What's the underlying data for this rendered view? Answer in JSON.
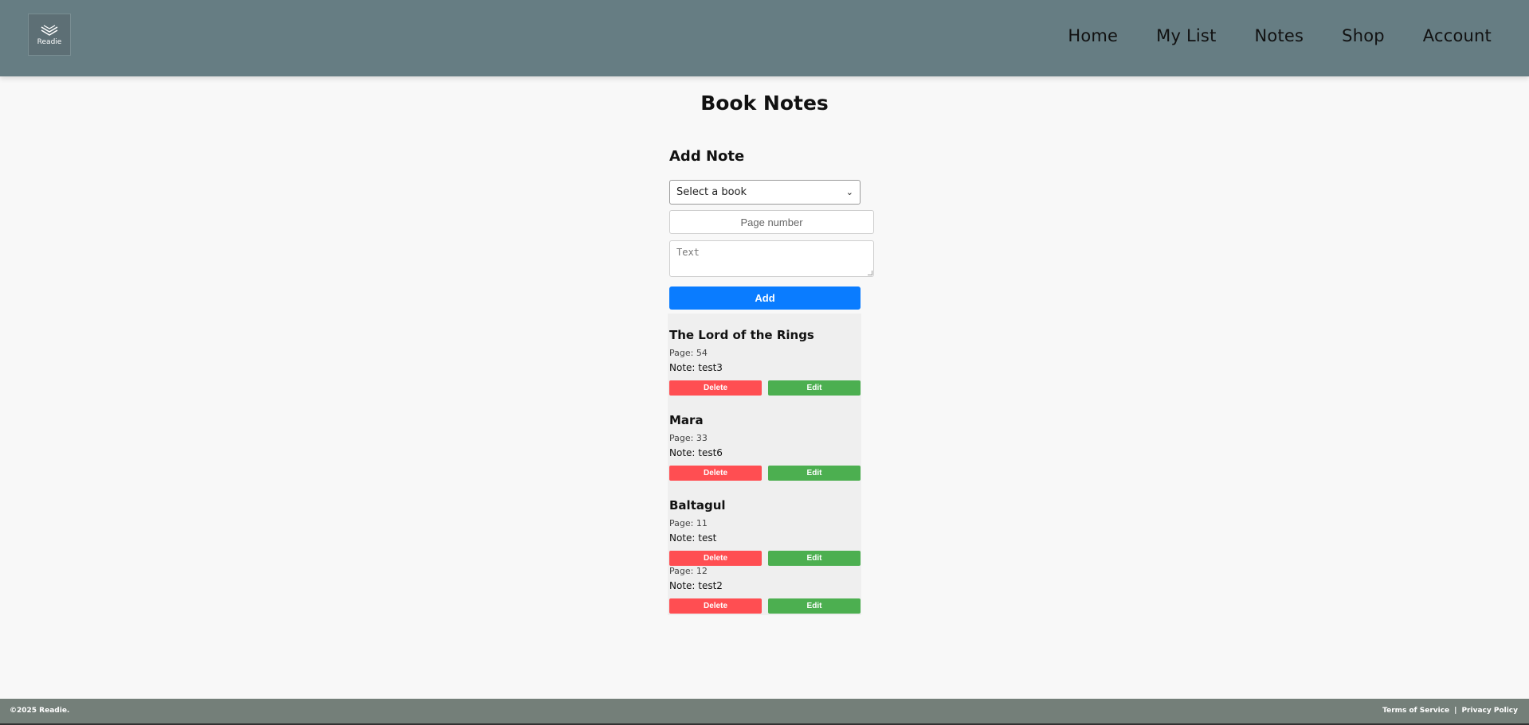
{
  "header": {
    "logo_text": "Readie",
    "nav": [
      "Home",
      "My List",
      "Notes",
      "Shop",
      "Account"
    ]
  },
  "page_title": "Book Notes",
  "form": {
    "title": "Add Note",
    "book_select_value": "Select a book",
    "page_placeholder": "Page number",
    "text_placeholder": "Text",
    "add_label": "Add"
  },
  "notes": [
    {
      "book": "The Lord of the Rings",
      "entries": [
        {
          "page": "Page: 54",
          "note": "Note: test3"
        }
      ]
    },
    {
      "book": "Mara",
      "entries": [
        {
          "page": "Page: 33",
          "note": "Note: test6"
        }
      ]
    },
    {
      "book": "Baltagul",
      "entries": [
        {
          "page": "Page: 11",
          "note": "Note: test"
        },
        {
          "page": "Page: 12",
          "note": "Note: test2"
        }
      ]
    }
  ],
  "buttons": {
    "delete": "Delete",
    "edit": "Edit"
  },
  "footer": {
    "copyright": "©2025 Readie.",
    "terms": "Terms of Service",
    "separator": "|",
    "privacy": "Privacy Policy"
  },
  "colors": {
    "header_bg": "#667d83",
    "add_button": "#0a7cff",
    "delete_button": "#ff4e52",
    "edit_button": "#4caf50",
    "footer_bg": "#747f79"
  }
}
